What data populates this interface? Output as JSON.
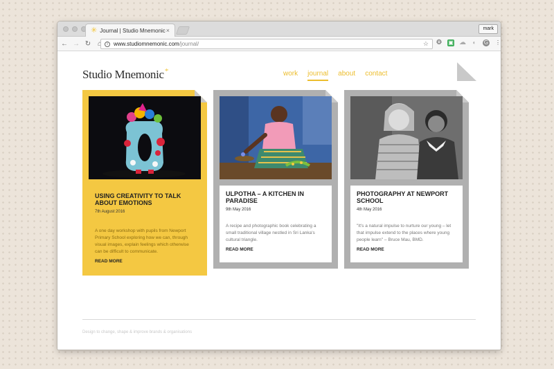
{
  "browser": {
    "tab_title": "Journal | Studio Mnemonic",
    "tab_close": "×",
    "profile_name": "mark",
    "url_host": "www.studiomnemonic.com",
    "url_path": "/journal/",
    "info_glyph": "i",
    "nav": {
      "back": "←",
      "forward": "→",
      "reload": "↻",
      "home": "⌂"
    },
    "star": "☆",
    "menu_glyph": "⋮"
  },
  "site": {
    "logo_text": "Studio Mnemonic",
    "logo_mark": "*",
    "accent_color": "#ecbd2d",
    "nav": [
      {
        "label": "work",
        "active": false
      },
      {
        "label": "journal",
        "active": true
      },
      {
        "label": "about",
        "active": false
      },
      {
        "label": "contact",
        "active": false
      }
    ]
  },
  "cards": [
    {
      "title": "USING CREATIVITY TO TALK ABOUT EMOTIONS",
      "date": "7th August 2016",
      "excerpt": "A one day workshop with pupils from Newport Primary School exploring how we can, through visual images, explain feelings which otherwise can be difficult to communicate.",
      "more": "READ MORE",
      "highlight": true
    },
    {
      "title": "ULPOTHA – A KITCHEN IN PARADISE",
      "date": "9th May 2016",
      "excerpt": "A recipe and photographic book celebrating a small traditional village nestled in Sri Lanka's cultural triangle.",
      "more": "READ MORE",
      "highlight": false
    },
    {
      "title": "PHOTOGRAPHY AT NEWPORT SCHOOL",
      "date": "4th May 2016",
      "excerpt": "\"It's a natural impulse to nurture our young – let that impulse extend to the places where young people learn\" – Bruce Mau, BMD.",
      "more": "READ MORE",
      "highlight": false
    }
  ],
  "footer": {
    "tagline": "Design to change, shape & improve brands & organisations"
  }
}
